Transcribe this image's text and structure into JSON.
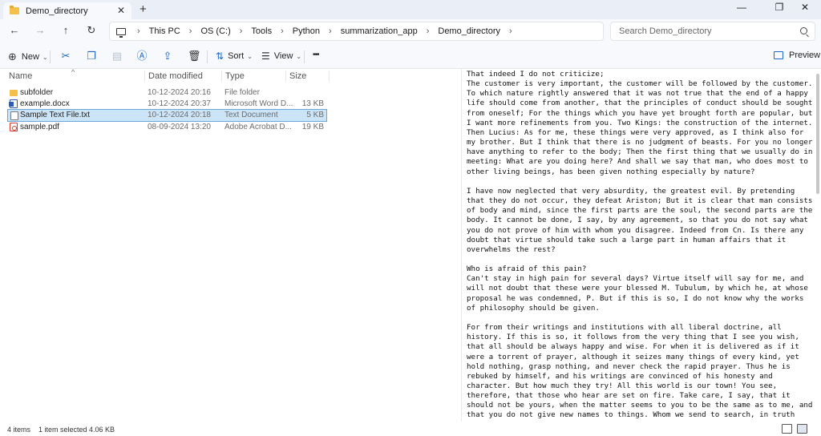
{
  "window": {
    "tab_title": "Demo_directory",
    "tab_close": "✕",
    "new_tab": "+",
    "minimize": "—",
    "maximize": "❐",
    "close": "✕"
  },
  "nav": {
    "back": "←",
    "forward": "→",
    "up": "↑",
    "refresh": "↻",
    "breadcrumbs": [
      "This PC",
      "OS (C:)",
      "Tools",
      "Python",
      "summarization_app",
      "Demo_directory"
    ],
    "separator": "›",
    "search_placeholder": "Search Demo_directory"
  },
  "commandbar": {
    "new_label": "New",
    "sort_label": "Sort",
    "view_label": "View",
    "more": "•••",
    "preview_label": "Preview",
    "caret": "⌄"
  },
  "columns": {
    "name": "Name",
    "date": "Date modified",
    "type": "Type",
    "size": "Size",
    "sort_caret": "^"
  },
  "files": [
    {
      "name": "subfolder",
      "date": "10-12-2024 20:16",
      "type": "File folder",
      "size": "",
      "icon": "folder-icon"
    },
    {
      "name": "example.docx",
      "date": "10-12-2024 20:37",
      "type": "Microsoft Word D...",
      "size": "13 KB",
      "icon": "word-doc-icon"
    },
    {
      "name": "Sample Text File.txt",
      "date": "10-12-2024 20:18",
      "type": "Text Document",
      "size": "5 KB",
      "icon": "text-file-icon",
      "selected": true
    },
    {
      "name": "sample.pdf",
      "date": "08-09-2024 13:20",
      "type": "Adobe Acrobat D...",
      "size": "19 KB",
      "icon": "pdf-icon"
    }
  ],
  "preview": {
    "text": "That indeed I do not criticize;\nThe customer is very important, the customer will be followed by the customer. To which nature rightly answered that it was not true that the end of a happy life should come from another, that the principles of conduct should be sought from oneself; For the things which you have yet brought forth are popular, but I want more refinements from you. Two Kings: the construction of the internet. Then Lucius: As for me, these things were very approved, as I think also for my brother. But I think that there is no judgment of beasts. For you no longer have anything to refer to the body; Then the first thing that we usually do in meeting: What are you doing here? And shall we say that man, who does most to other living beings, has been given nothing especially by nature?\n\nI have now neglected that very absurdity, the greatest evil. By pretending that they do not occur, they defeat Ariston; But it is clear that man consists of body and mind, since the first parts are the soul, the second parts are the body. It cannot be done, I say, by any agreement, so that you do not say what you do not prove of him with whom you disagree. Indeed from Cn. Is there any doubt that virtue should take such a large part in human affairs that it overwhelms the rest?\n\nWho is afraid of this pain?\nCan't stay in high pain for several days? Virtue itself will say for me, and will not doubt that these were your blessed M. Tubulum, by which he, at whose proposal he was condemned, P. But if this is so, I do not know why the works of philosophy should be given.\n\nFor from their writings and institutions with all liberal doctrine, all history. If this is so, it follows from the very thing that I see you wish, that all should be always happy and wise. For when it is delivered as if it were a torrent of prayer, although it seizes many things of every kind, yet hold nothing, grasp nothing, and never check the rapid prayer. Thus he is rebuked by himself, and his writings are convinced of his honesty and character. But how much they try! All this world is our town! You see, therefore, that those who hear are set on fire. Take care, I say, that it should not be yours, when the matter seems to you to be the same as to me, and that you do not give new names to things. Whom we send to search, in truth falsely, is said to have deprived himself of his eyes; If these are the evils into which a wise man may fall, it is not enough to be wise to live happily. But indeed, if sense comes to the"
  },
  "status": {
    "count": "4 items",
    "selection": "1 item selected  4.06 KB"
  }
}
